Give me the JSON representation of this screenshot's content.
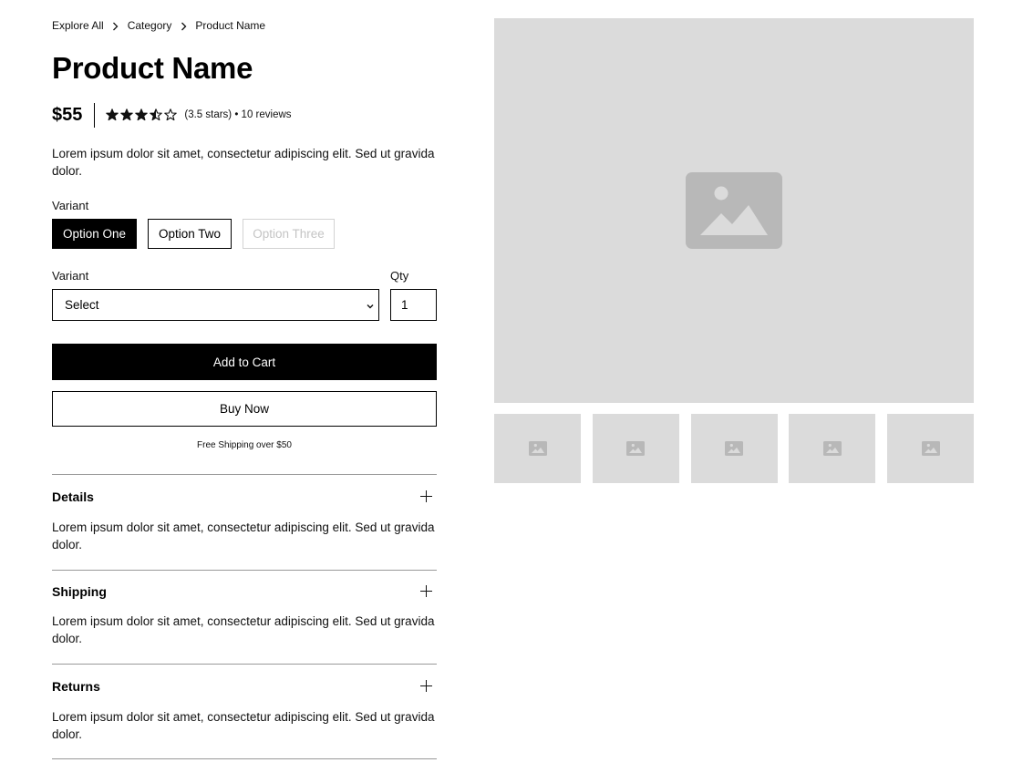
{
  "breadcrumb": {
    "items": [
      "Explore All",
      "Category",
      "Product Name"
    ]
  },
  "product": {
    "title": "Product Name",
    "price": "$55",
    "rating_value": 3.5,
    "rating_max": 5,
    "rating_text": "(3.5 stars) • 10 reviews",
    "description": "Lorem ipsum dolor sit amet, consectetur adipiscing elit. Sed ut gravida dolor."
  },
  "variant_buttons": {
    "label": "Variant",
    "options": [
      "Option One",
      "Option Two",
      "Option Three"
    ],
    "selected": "Option One",
    "disabled": "Option Three"
  },
  "variant_select": {
    "label": "Variant",
    "value": "Select"
  },
  "quantity": {
    "label": "Qty",
    "value": "1"
  },
  "actions": {
    "add_to_cart": "Add to Cart",
    "buy_now": "Buy Now",
    "shipping_note": "Free Shipping over $50"
  },
  "accordion": [
    {
      "title": "Details",
      "body": "Lorem ipsum dolor sit amet, consectetur adipiscing elit. Sed ut gravida dolor."
    },
    {
      "title": "Shipping",
      "body": "Lorem ipsum dolor sit amet, consectetur adipiscing elit. Sed ut gravida dolor."
    },
    {
      "title": "Returns",
      "body": "Lorem ipsum dolor sit amet, consectetur adipiscing elit. Sed ut gravida dolor."
    }
  ],
  "gallery": {
    "main_image_icon": "image-placeholder-icon",
    "thumbnail_icon": "image-placeholder-icon",
    "thumbnail_count": 5
  },
  "colors": {
    "primary": "#000000",
    "placeholder_bg": "#dbdbdb",
    "placeholder_icon": "#b8b8b8",
    "disabled": "#c4c4c4"
  }
}
